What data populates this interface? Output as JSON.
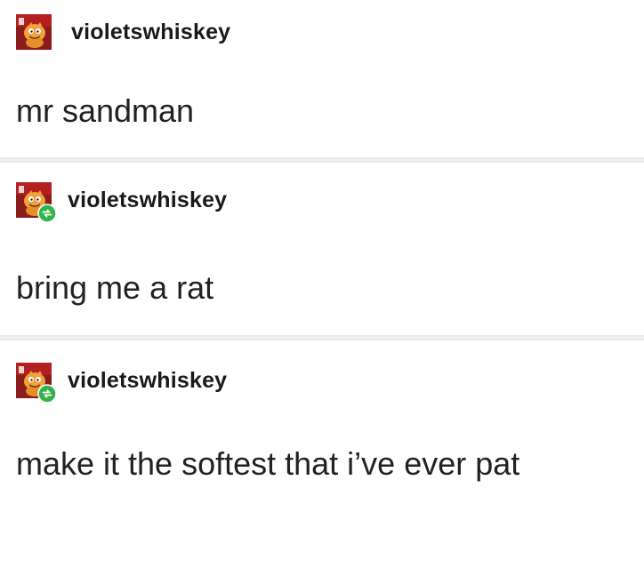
{
  "posts": [
    {
      "username": "violetswhiskey",
      "avatar_icon": "garfield-avatar-icon",
      "reblog_badge": false,
      "text": "mr sandman"
    },
    {
      "username": "violetswhiskey",
      "avatar_icon": "garfield-avatar-icon",
      "reblog_badge": true,
      "reblog_icon": "reblog-icon",
      "text": "bring me a rat"
    },
    {
      "username": "violetswhiskey",
      "avatar_icon": "garfield-avatar-icon",
      "reblog_badge": true,
      "reblog_icon": "reblog-icon",
      "text": "make it the softest that i’ve ever pat"
    }
  ],
  "colors": {
    "background": "#ffffff",
    "divider": "#e6e6e6",
    "text": "#222222",
    "reblog_badge": "#34b34a",
    "avatar_bg": "#8a1c1c",
    "avatar_accent": "#f2a13a"
  }
}
